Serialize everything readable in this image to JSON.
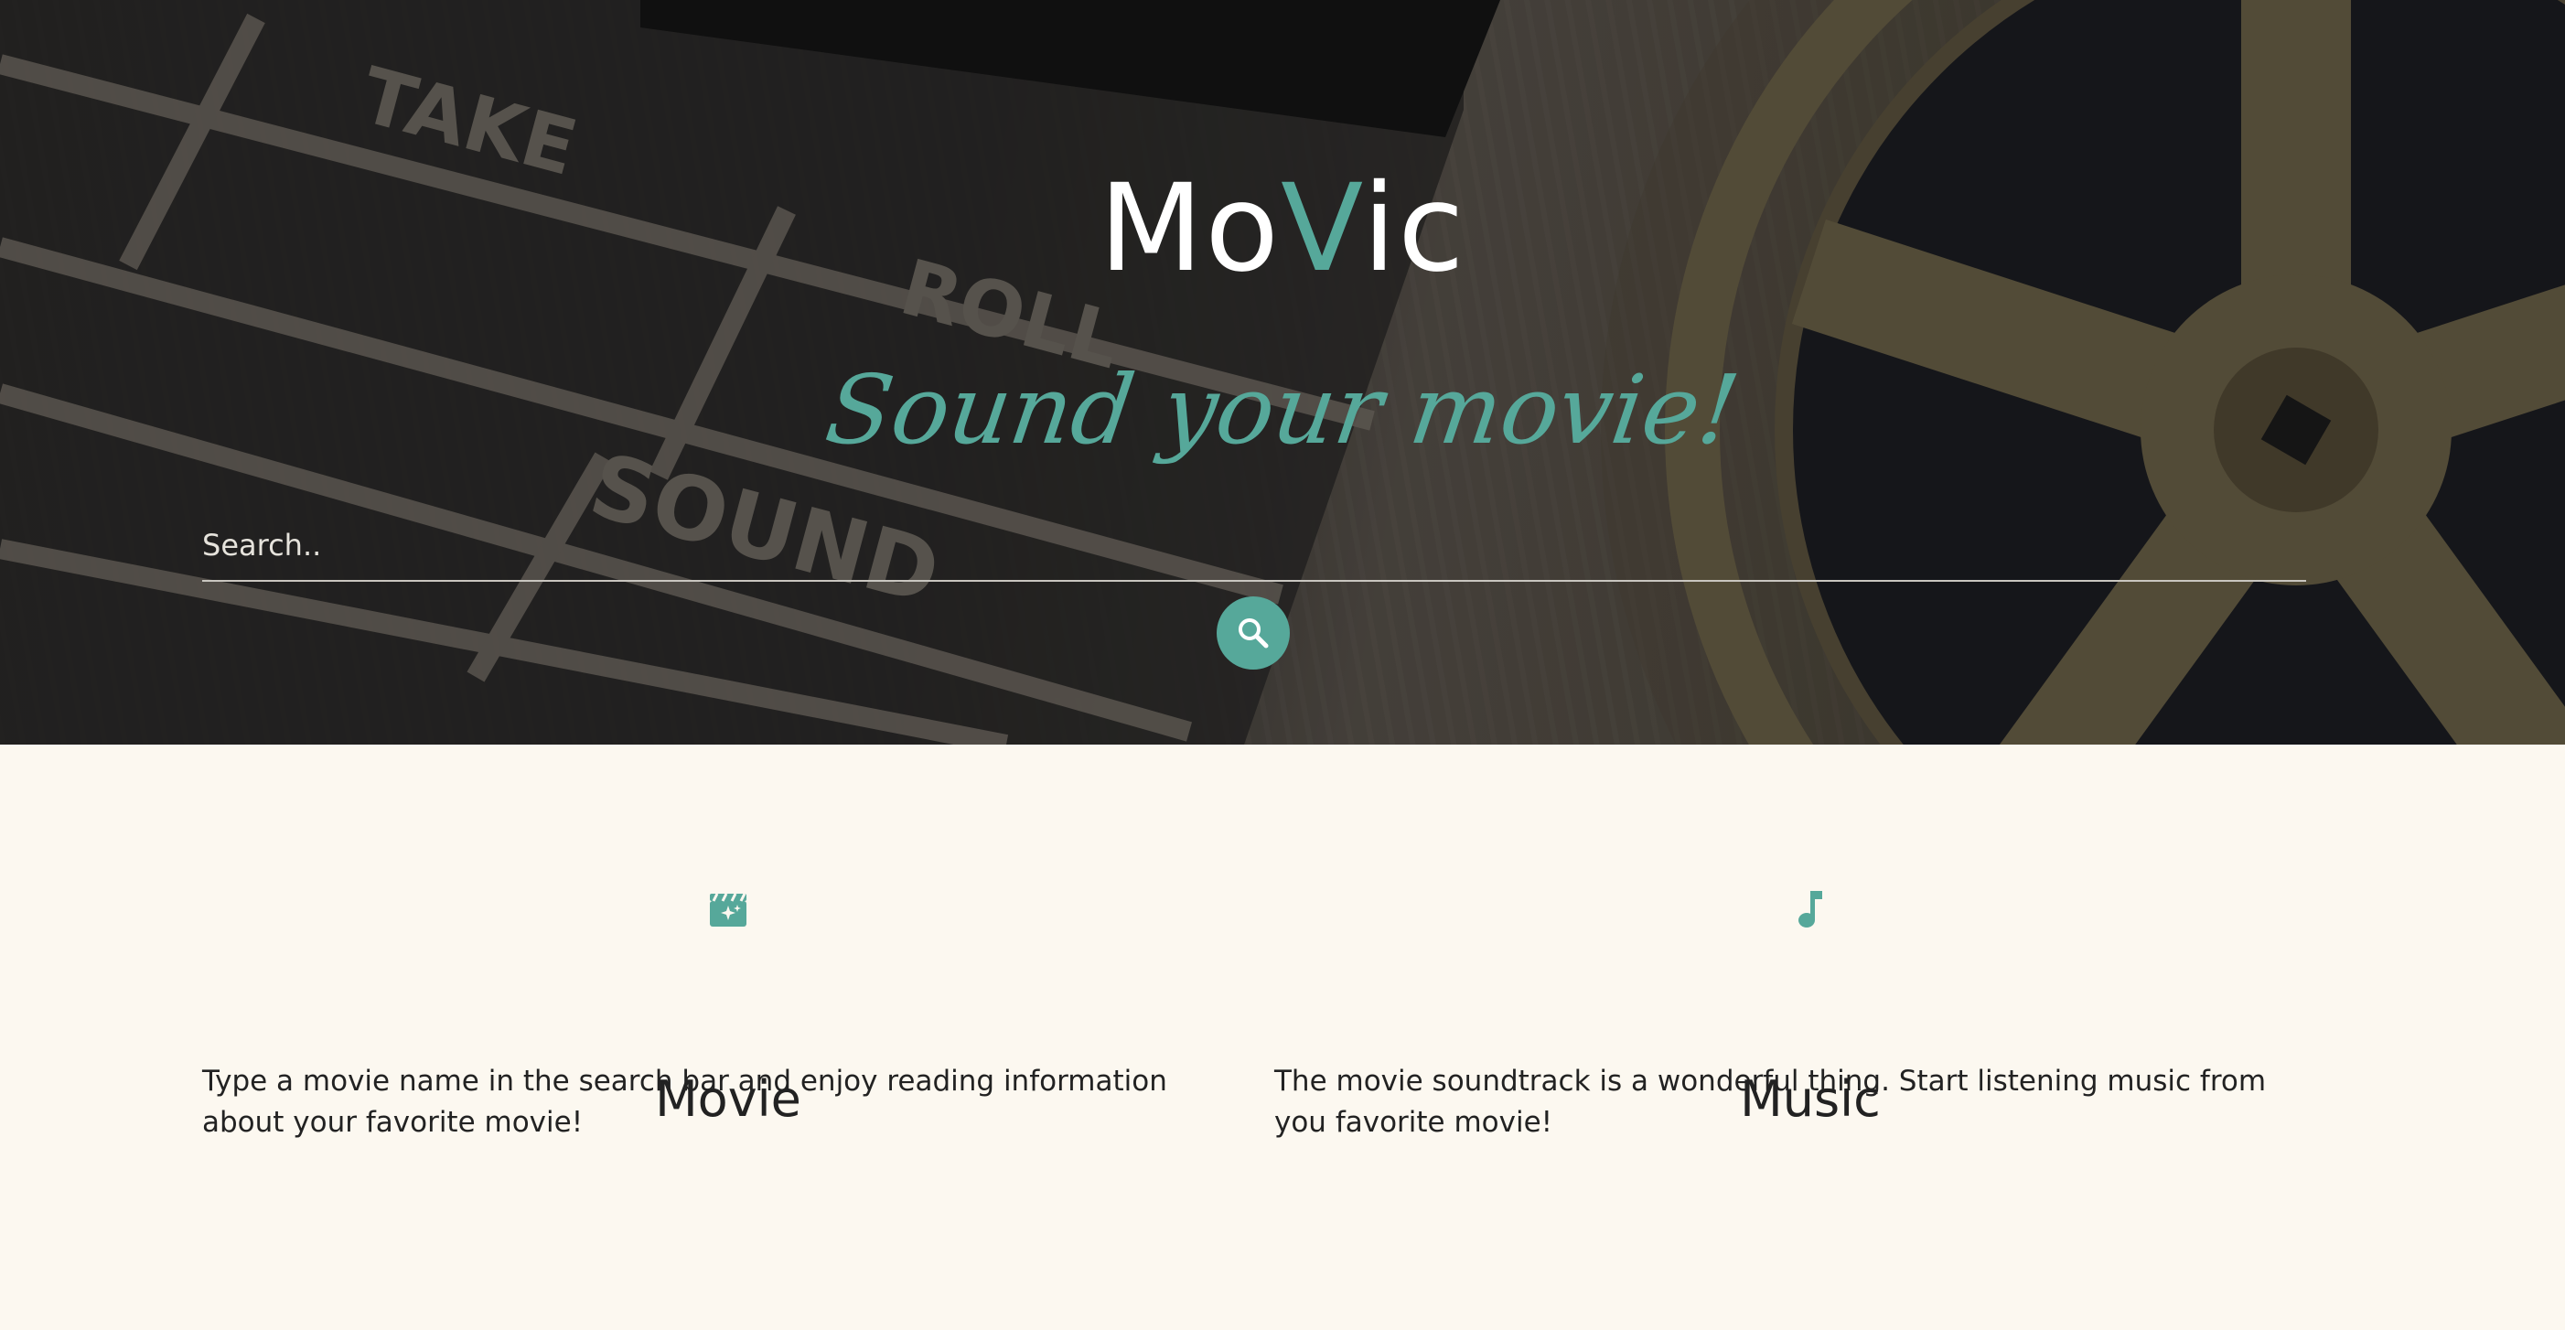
{
  "header": {
    "brand": {
      "part1": "Mo",
      "accent": "V",
      "part2": "ic"
    },
    "tagline": "Sound your movie!",
    "search": {
      "placeholder": "Search..",
      "value": ""
    },
    "search_button_icon": "search-icon"
  },
  "features": [
    {
      "icon": "movie-clapper-icon",
      "title": "Movie",
      "text": "Type a movie name in the search bar and enjoy reading information about your favorite movie!"
    },
    {
      "icon": "music-note-icon",
      "title": "Music",
      "text": "The movie soundtrack is a wonderful thing. Start listening music from you favorite movie!"
    }
  ],
  "colors": {
    "accent": "#56a89a",
    "page_background": "#fcf8f0",
    "text": "#222222"
  }
}
